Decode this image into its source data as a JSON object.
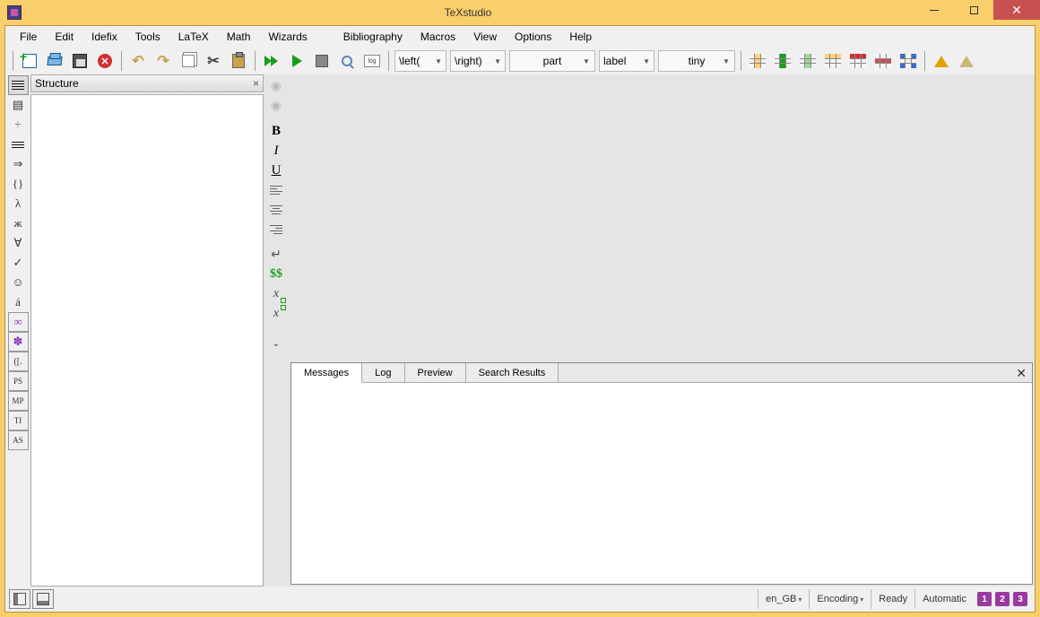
{
  "title": "TeXstudio",
  "menu": [
    "File",
    "Edit",
    "Idefix",
    "Tools",
    "LaTeX",
    "Math",
    "Wizards",
    "Bibliography",
    "Macros",
    "View",
    "Options",
    "Help"
  ],
  "toolbar_dropdowns": {
    "left_delim": "\\left(",
    "right_delim": "\\right)",
    "section": "part",
    "ref": "label",
    "font_size": "tiny"
  },
  "structure_panel": {
    "title": "Structure"
  },
  "left_strip_icons": [
    "list-icon",
    "bookmarks-icon",
    "divide-icon",
    "lines-icon",
    "arrow-icon",
    "braces-icon",
    "lambda-icon",
    "zhe-icon",
    "forall-icon",
    "check-icon",
    "smiley-icon",
    "acute-a-icon",
    "infinity-icon",
    "asterisk-icon",
    "brackets-icon",
    "ps-icon",
    "mp-icon",
    "ti-icon",
    "as-icon"
  ],
  "left_strip_glyphs": [
    "≡",
    "▤",
    "÷",
    "≡",
    "⇒",
    "{}",
    "λ",
    "ж",
    "∀",
    "✓",
    "☺",
    "á",
    "∞",
    "✽",
    "([.",
    "PS",
    "MP",
    "TI",
    "AS"
  ],
  "vtoolbar": [
    {
      "name": "nav-back-icon",
      "glyph": "◄",
      "cls": "dim"
    },
    {
      "name": "nav-fwd-icon",
      "glyph": "►",
      "cls": "dim"
    },
    {
      "name": "bold-btn",
      "glyph": "B",
      "cls": "bold"
    },
    {
      "name": "italic-btn",
      "glyph": "I",
      "cls": "italic"
    },
    {
      "name": "underline-btn",
      "glyph": "U",
      "cls": "under"
    },
    {
      "name": "align-left-btn",
      "glyph": "",
      "cls": "al-l align"
    },
    {
      "name": "align-center-btn",
      "glyph": "",
      "cls": "al-c align"
    },
    {
      "name": "align-right-btn",
      "glyph": "",
      "cls": "al-r align"
    },
    {
      "name": "newline-btn",
      "glyph": "↵",
      "cls": ""
    },
    {
      "name": "inline-math-btn",
      "glyph": "$$",
      "cls": "green"
    },
    {
      "name": "subscript-btn",
      "glyph": "x",
      "cls": "mathit sub"
    },
    {
      "name": "superscript-btn",
      "glyph": "x",
      "cls": "mathit sup"
    }
  ],
  "bottom_tabs": [
    "Messages",
    "Log",
    "Preview",
    "Search Results"
  ],
  "bottom_active_tab": 0,
  "statusbar": {
    "lang": "en_GB",
    "encoding": "Encoding",
    "compile_status": "Ready",
    "auto": "Automatic",
    "markers": [
      "1",
      "2",
      "3"
    ]
  },
  "log_label": "log"
}
